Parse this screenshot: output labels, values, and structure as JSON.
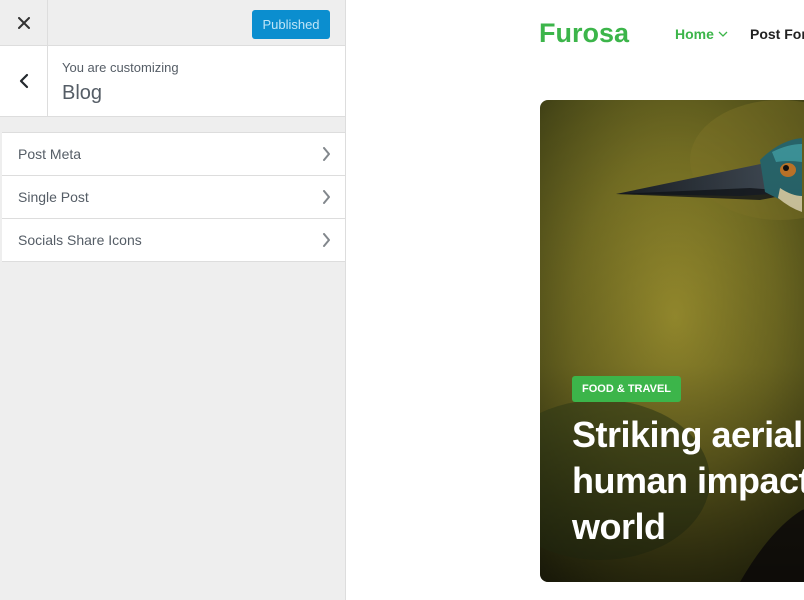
{
  "customizer": {
    "publish_label": "Published",
    "customizing_label": "You are customizing",
    "section_title": "Blog",
    "items": [
      {
        "label": "Post Meta"
      },
      {
        "label": "Single Post"
      },
      {
        "label": "Socials Share Icons"
      }
    ]
  },
  "site": {
    "logo": "Furosa",
    "nav": {
      "home": "Home",
      "post_formats": "Post Form"
    },
    "hero": {
      "category": "FOOD & TRAVEL",
      "title_lines": [
        "Striking aerial p",
        "human impact o",
        "world"
      ]
    }
  },
  "colors": {
    "accent_green": "#3cb54a",
    "publish_blue": "#0b8ecf"
  }
}
